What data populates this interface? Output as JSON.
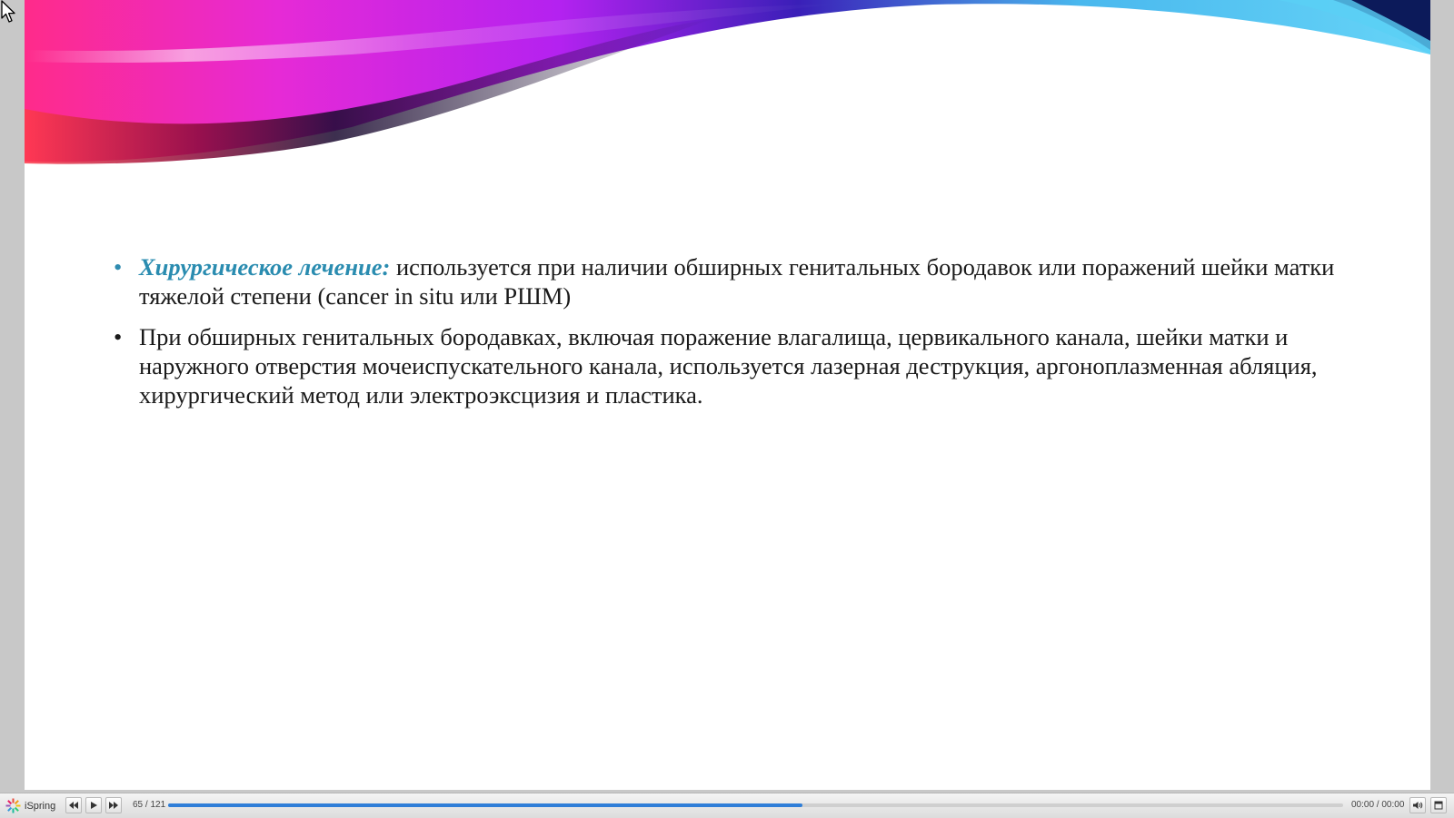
{
  "player": {
    "brand_label": "iSpring",
    "slide_counter": "65 / 121",
    "progress_fraction": 0.54,
    "time_readout": "00:00 / 00:00",
    "accent_color": "#2f7ed8"
  },
  "slide": {
    "bullets": [
      {
        "lead": "Хирургическое лечение:",
        "text": " используется при наличии обширных генитальных бородавок или поражений шейки матки тяжелой степени (cancer in situ или РШМ)"
      },
      {
        "lead": "",
        "text": "При обширных генитальных бородавках, включая поражение влагалища, цервикального канала, шейки матки и наружного отверстия мочеиспускательного канала, используется лазерная деструкция, аргоноплазменная абляция, хирургический метод или электроэксцизия и пластика."
      }
    ],
    "lead_color": "#2a8cb0"
  },
  "icons": {
    "cursor": "mouse-pointer-icon",
    "brand": "ispring-logo-icon",
    "prev": "skip-back-icon",
    "play": "play-icon",
    "next": "skip-forward-icon",
    "volume": "volume-icon",
    "fullscreen": "fullscreen-icon"
  }
}
